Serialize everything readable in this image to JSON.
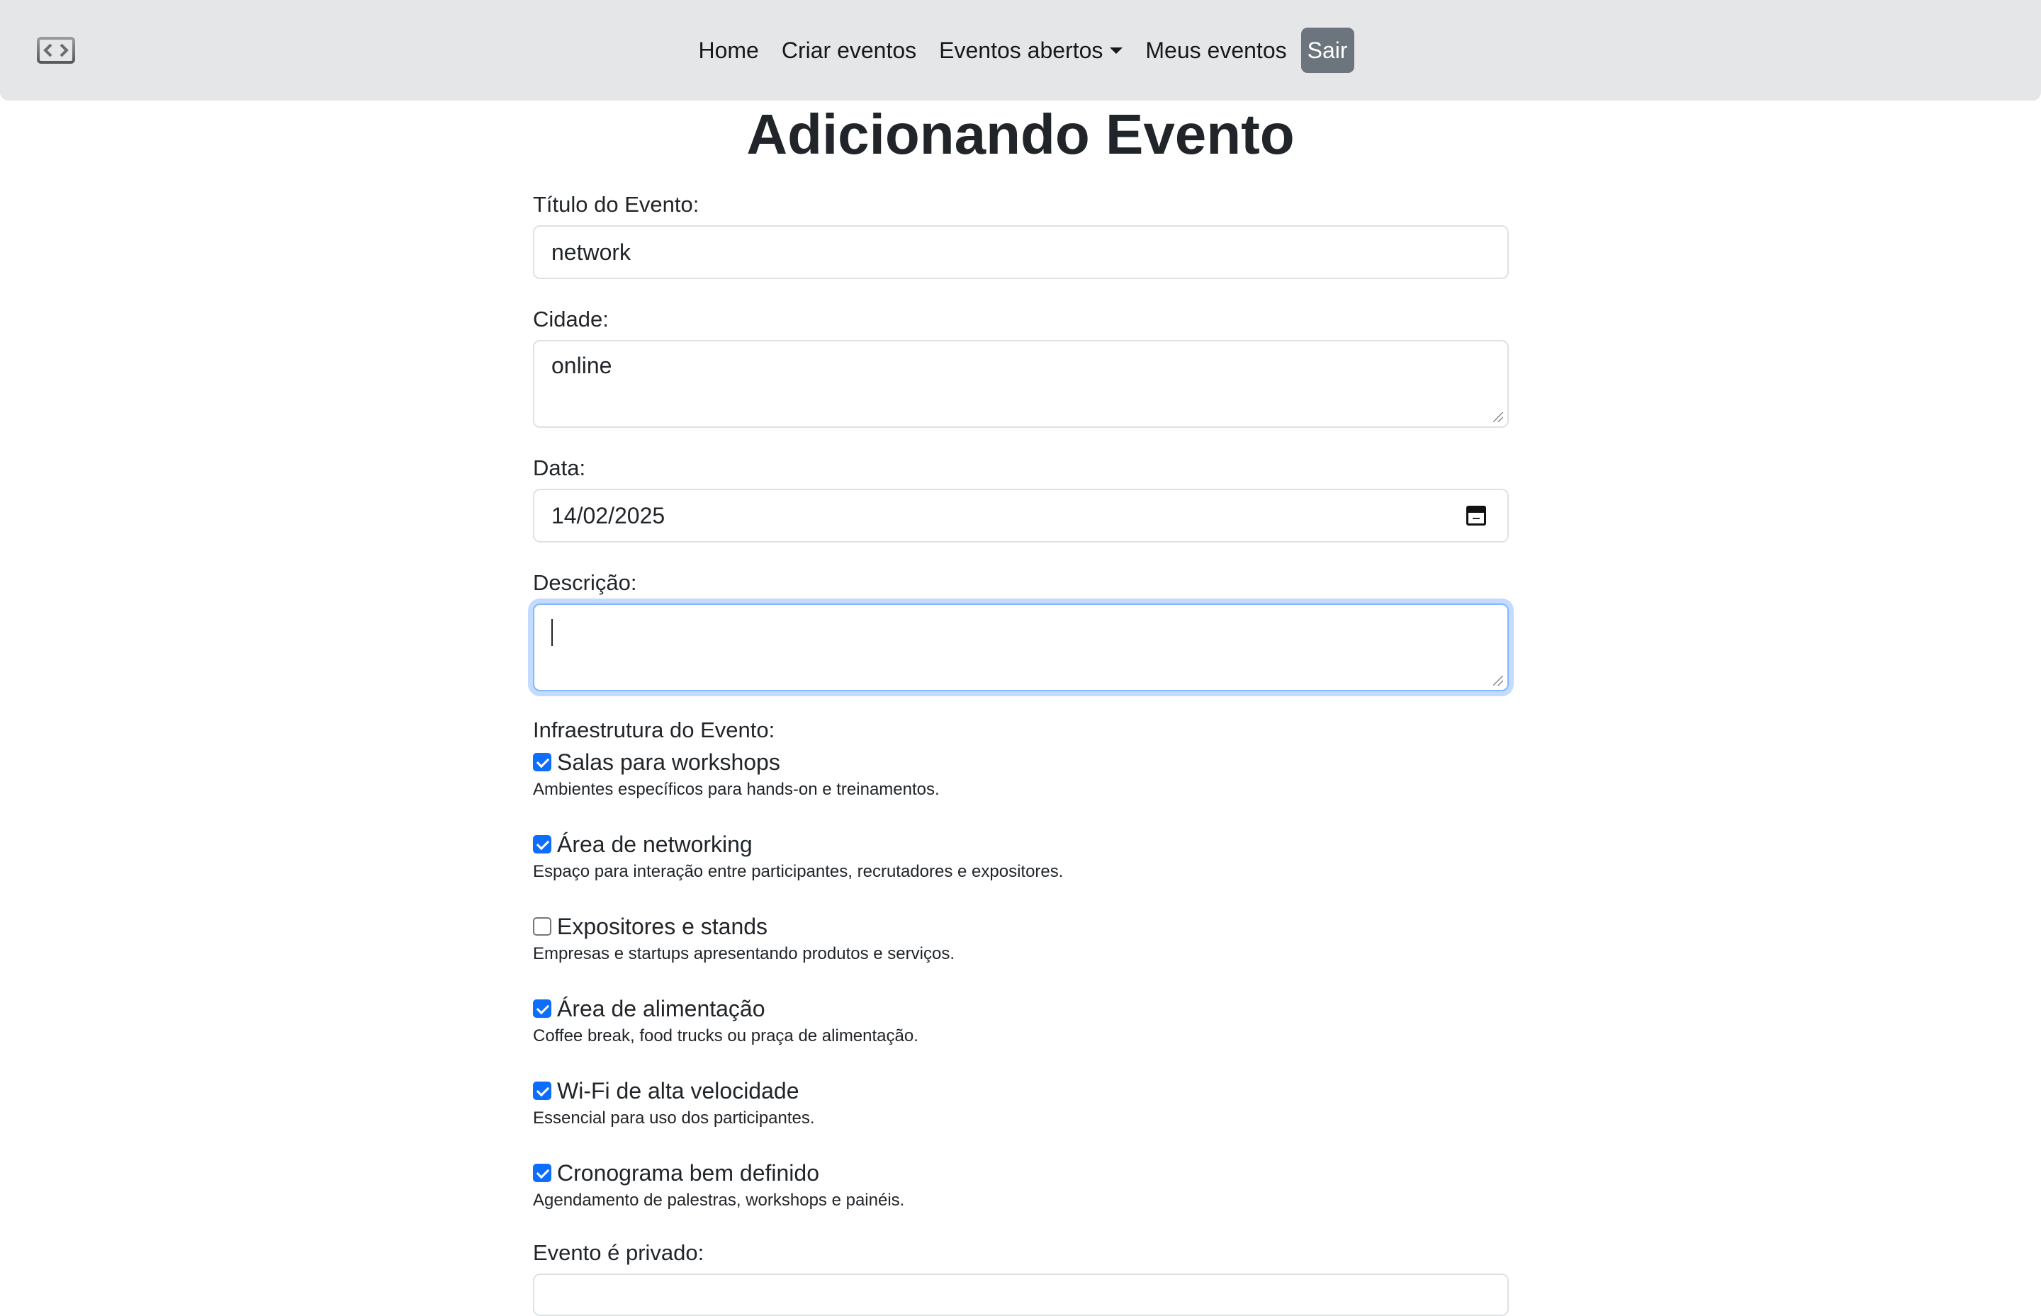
{
  "navbar": {
    "logo_icon": "code-brackets-logo-icon",
    "links": [
      {
        "label": "Home"
      },
      {
        "label": "Criar eventos"
      },
      {
        "label": "Eventos abertos"
      },
      {
        "label": "Meus eventos"
      }
    ],
    "logout_label": "Sair"
  },
  "page": {
    "title": "Adicionando Evento"
  },
  "form": {
    "title_label": "Título do Evento:",
    "title_value": "network",
    "city_label": "Cidade:",
    "city_value": "online",
    "date_label": "Data:",
    "date_value": "14/02/2025",
    "date_icon": "calendar-icon",
    "description_label": "Descrição:",
    "description_value": "",
    "infra_label": "Infraestrutura do Evento:",
    "infra_items": [
      {
        "label": "Salas para workshops",
        "description": "Ambientes específicos para hands-on e treinamentos.",
        "checked": true
      },
      {
        "label": "Área de networking",
        "description": "Espaço para interação entre participantes, recrutadores e expositores.",
        "checked": true
      },
      {
        "label": "Expositores e stands",
        "description": "Empresas e startups apresentando produtos e serviços.",
        "checked": false
      },
      {
        "label": "Área de alimentação",
        "description": "Coffee break, food trucks ou praça de alimentação.",
        "checked": true
      },
      {
        "label": "Wi-Fi de alta velocidade",
        "description": "Essencial para uso dos participantes.",
        "checked": true
      },
      {
        "label": "Cronograma bem definido",
        "description": "Agendamento de palestras, workshops e painéis.",
        "checked": true
      }
    ],
    "private_label": "Evento é privado:"
  },
  "colors": {
    "navbar_bg": "#e5e6e8",
    "accent": "#0d6efd",
    "logout_bg": "#6c757d",
    "focus_ring": "#86b7fe"
  }
}
